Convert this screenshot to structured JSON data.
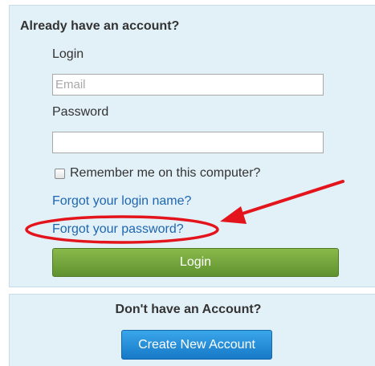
{
  "login_panel": {
    "title": "Already have an account?",
    "login_label": "Login",
    "email_placeholder": "Email",
    "email_value": "",
    "password_label": "Password",
    "password_value": "",
    "remember_label": "Remember me on this computer?",
    "remember_checked": false,
    "forgot_login_link": "Forgot your login name?",
    "forgot_password_link": "Forgot your password?",
    "login_button": "Login"
  },
  "signup_panel": {
    "title": "Don't have an Account?",
    "create_button": "Create New Account"
  },
  "colors": {
    "panel_background": "#e2f0f8",
    "link": "#1f66b0",
    "login_button": "#6f9f3a",
    "create_button": "#2590dc",
    "annotation": "#e3141b"
  },
  "annotation": {
    "highlight": "ellipse around forgot-password link",
    "arrow": "red arrow pointing at forgot-password link"
  }
}
